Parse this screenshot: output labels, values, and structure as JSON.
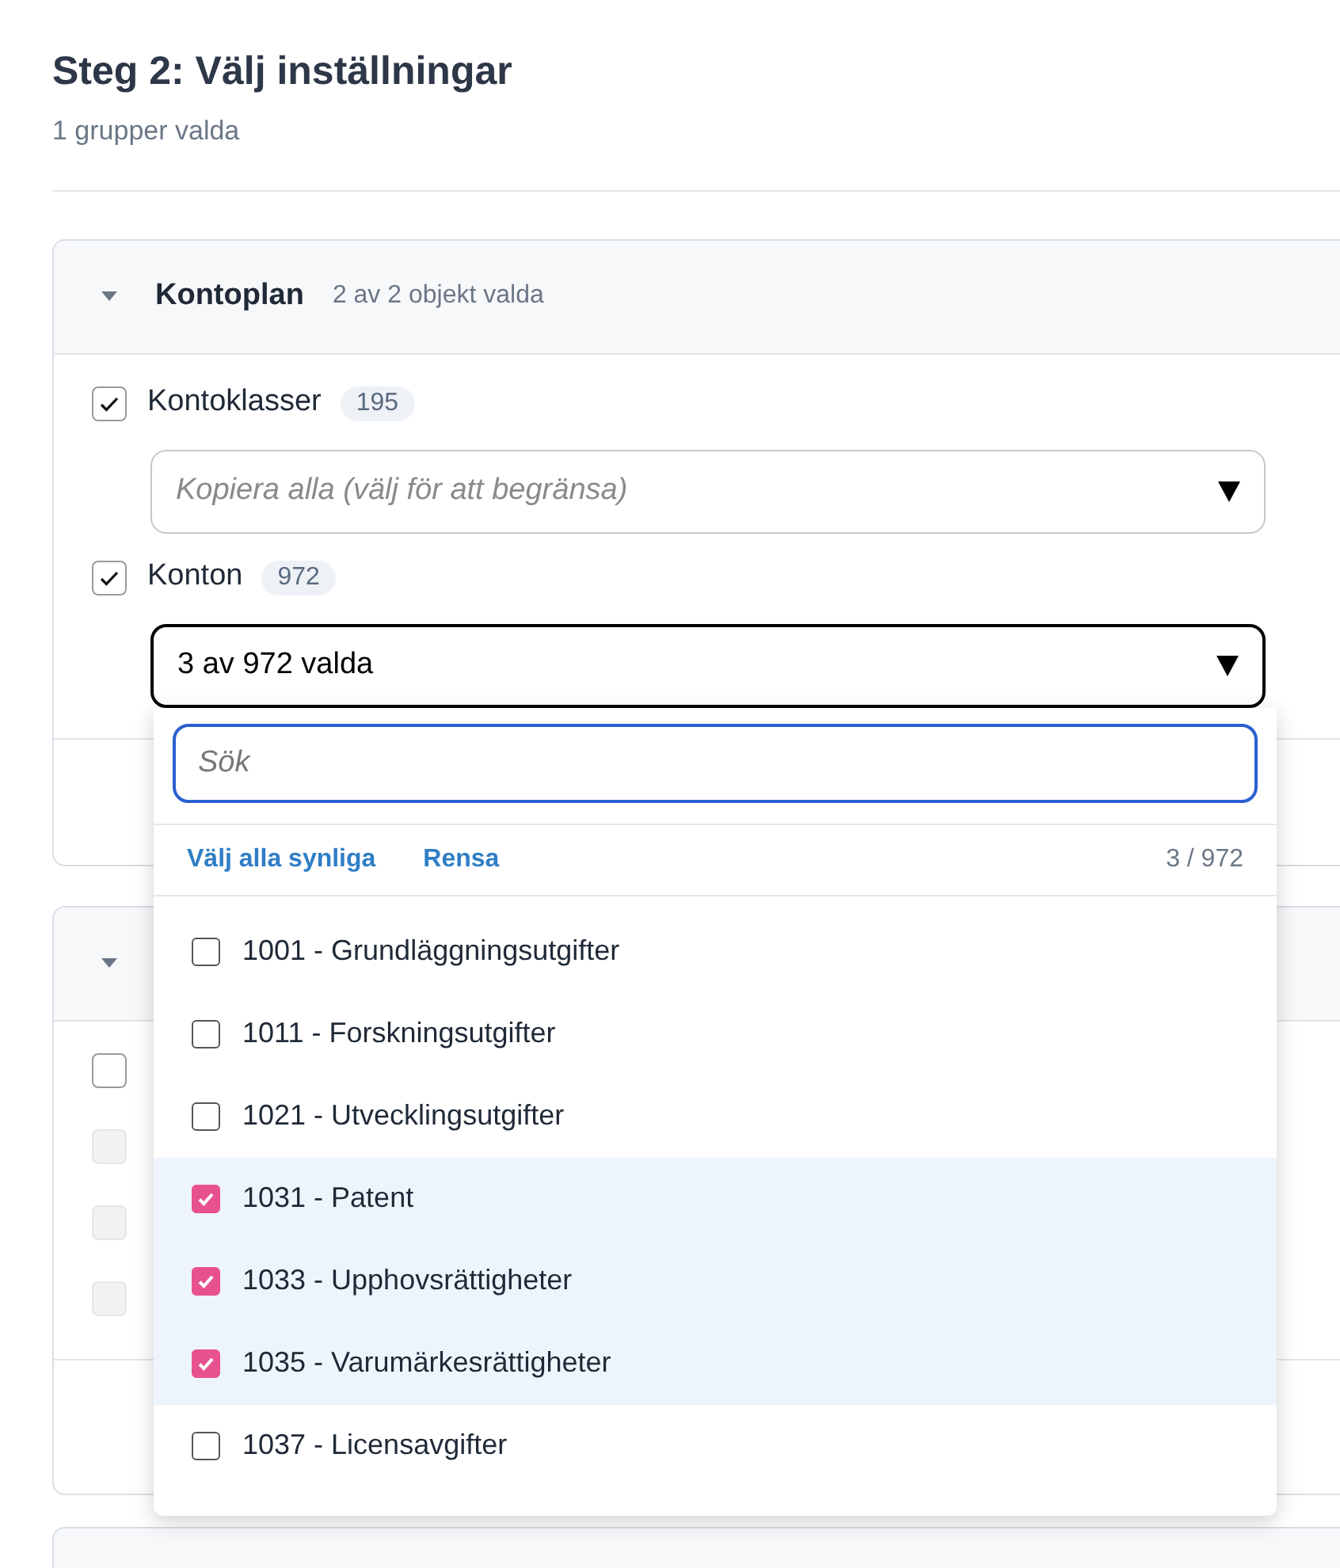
{
  "page": {
    "title": "Steg 2: Välj inställningar",
    "subtitle": "1 grupper valda"
  },
  "groups": [
    {
      "title": "Kontoplan",
      "summary": "2 av 2 objekt valda",
      "expanded": true,
      "items": [
        {
          "label": "Kontoklasser",
          "count": "195",
          "checked": true,
          "disabled": false,
          "select": {
            "placeholder": "Kopiera alla (välj för att begränsa)",
            "open": false
          }
        },
        {
          "label": "Konton",
          "count": "972",
          "checked": true,
          "disabled": false,
          "select": {
            "value": "3 av 972 valda",
            "open": true
          }
        }
      ]
    },
    {
      "expanded": true,
      "items": [
        {
          "checked": false,
          "disabled": false
        },
        {
          "checked": false,
          "disabled": true
        },
        {
          "checked": false,
          "disabled": true
        },
        {
          "checked": false,
          "disabled": true
        }
      ]
    }
  ],
  "dropdown": {
    "search": {
      "placeholder": "Sök"
    },
    "actions": [
      "Välj alla synliga",
      "Rensa"
    ],
    "counter": "3 / 972",
    "options": [
      {
        "label": "1001 - Grundläggningsutgifter",
        "checked": false
      },
      {
        "label": "1011 - Forskningsutgifter",
        "checked": false
      },
      {
        "label": "1021 - Utvecklingsutgifter",
        "checked": false
      },
      {
        "label": "1031 - Patent",
        "checked": true
      },
      {
        "label": "1033 - Upphovsrättigheter",
        "checked": true
      },
      {
        "label": "1035 - Varumärkesrättigheter",
        "checked": true
      },
      {
        "label": "1037 - Licensavgifter",
        "checked": false
      }
    ]
  }
}
